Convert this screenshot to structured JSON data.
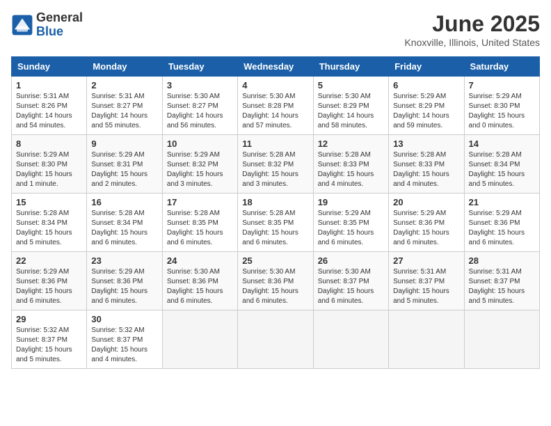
{
  "logo": {
    "general": "General",
    "blue": "Blue"
  },
  "title": "June 2025",
  "location": "Knoxville, Illinois, United States",
  "days_header": [
    "Sunday",
    "Monday",
    "Tuesday",
    "Wednesday",
    "Thursday",
    "Friday",
    "Saturday"
  ],
  "weeks": [
    [
      {
        "day": "1",
        "info": "Sunrise: 5:31 AM\nSunset: 8:26 PM\nDaylight: 14 hours\nand 54 minutes."
      },
      {
        "day": "2",
        "info": "Sunrise: 5:31 AM\nSunset: 8:27 PM\nDaylight: 14 hours\nand 55 minutes."
      },
      {
        "day": "3",
        "info": "Sunrise: 5:30 AM\nSunset: 8:27 PM\nDaylight: 14 hours\nand 56 minutes."
      },
      {
        "day": "4",
        "info": "Sunrise: 5:30 AM\nSunset: 8:28 PM\nDaylight: 14 hours\nand 57 minutes."
      },
      {
        "day": "5",
        "info": "Sunrise: 5:30 AM\nSunset: 8:29 PM\nDaylight: 14 hours\nand 58 minutes."
      },
      {
        "day": "6",
        "info": "Sunrise: 5:29 AM\nSunset: 8:29 PM\nDaylight: 14 hours\nand 59 minutes."
      },
      {
        "day": "7",
        "info": "Sunrise: 5:29 AM\nSunset: 8:30 PM\nDaylight: 15 hours\nand 0 minutes."
      }
    ],
    [
      {
        "day": "8",
        "info": "Sunrise: 5:29 AM\nSunset: 8:30 PM\nDaylight: 15 hours\nand 1 minute."
      },
      {
        "day": "9",
        "info": "Sunrise: 5:29 AM\nSunset: 8:31 PM\nDaylight: 15 hours\nand 2 minutes."
      },
      {
        "day": "10",
        "info": "Sunrise: 5:29 AM\nSunset: 8:32 PM\nDaylight: 15 hours\nand 3 minutes."
      },
      {
        "day": "11",
        "info": "Sunrise: 5:28 AM\nSunset: 8:32 PM\nDaylight: 15 hours\nand 3 minutes."
      },
      {
        "day": "12",
        "info": "Sunrise: 5:28 AM\nSunset: 8:33 PM\nDaylight: 15 hours\nand 4 minutes."
      },
      {
        "day": "13",
        "info": "Sunrise: 5:28 AM\nSunset: 8:33 PM\nDaylight: 15 hours\nand 4 minutes."
      },
      {
        "day": "14",
        "info": "Sunrise: 5:28 AM\nSunset: 8:34 PM\nDaylight: 15 hours\nand 5 minutes."
      }
    ],
    [
      {
        "day": "15",
        "info": "Sunrise: 5:28 AM\nSunset: 8:34 PM\nDaylight: 15 hours\nand 5 minutes."
      },
      {
        "day": "16",
        "info": "Sunrise: 5:28 AM\nSunset: 8:34 PM\nDaylight: 15 hours\nand 6 minutes."
      },
      {
        "day": "17",
        "info": "Sunrise: 5:28 AM\nSunset: 8:35 PM\nDaylight: 15 hours\nand 6 minutes."
      },
      {
        "day": "18",
        "info": "Sunrise: 5:28 AM\nSunset: 8:35 PM\nDaylight: 15 hours\nand 6 minutes."
      },
      {
        "day": "19",
        "info": "Sunrise: 5:29 AM\nSunset: 8:35 PM\nDaylight: 15 hours\nand 6 minutes."
      },
      {
        "day": "20",
        "info": "Sunrise: 5:29 AM\nSunset: 8:36 PM\nDaylight: 15 hours\nand 6 minutes."
      },
      {
        "day": "21",
        "info": "Sunrise: 5:29 AM\nSunset: 8:36 PM\nDaylight: 15 hours\nand 6 minutes."
      }
    ],
    [
      {
        "day": "22",
        "info": "Sunrise: 5:29 AM\nSunset: 8:36 PM\nDaylight: 15 hours\nand 6 minutes."
      },
      {
        "day": "23",
        "info": "Sunrise: 5:29 AM\nSunset: 8:36 PM\nDaylight: 15 hours\nand 6 minutes."
      },
      {
        "day": "24",
        "info": "Sunrise: 5:30 AM\nSunset: 8:36 PM\nDaylight: 15 hours\nand 6 minutes."
      },
      {
        "day": "25",
        "info": "Sunrise: 5:30 AM\nSunset: 8:36 PM\nDaylight: 15 hours\nand 6 minutes."
      },
      {
        "day": "26",
        "info": "Sunrise: 5:30 AM\nSunset: 8:37 PM\nDaylight: 15 hours\nand 6 minutes."
      },
      {
        "day": "27",
        "info": "Sunrise: 5:31 AM\nSunset: 8:37 PM\nDaylight: 15 hours\nand 5 minutes."
      },
      {
        "day": "28",
        "info": "Sunrise: 5:31 AM\nSunset: 8:37 PM\nDaylight: 15 hours\nand 5 minutes."
      }
    ],
    [
      {
        "day": "29",
        "info": "Sunrise: 5:32 AM\nSunset: 8:37 PM\nDaylight: 15 hours\nand 5 minutes."
      },
      {
        "day": "30",
        "info": "Sunrise: 5:32 AM\nSunset: 8:37 PM\nDaylight: 15 hours\nand 4 minutes."
      },
      {
        "day": "",
        "info": ""
      },
      {
        "day": "",
        "info": ""
      },
      {
        "day": "",
        "info": ""
      },
      {
        "day": "",
        "info": ""
      },
      {
        "day": "",
        "info": ""
      }
    ]
  ]
}
